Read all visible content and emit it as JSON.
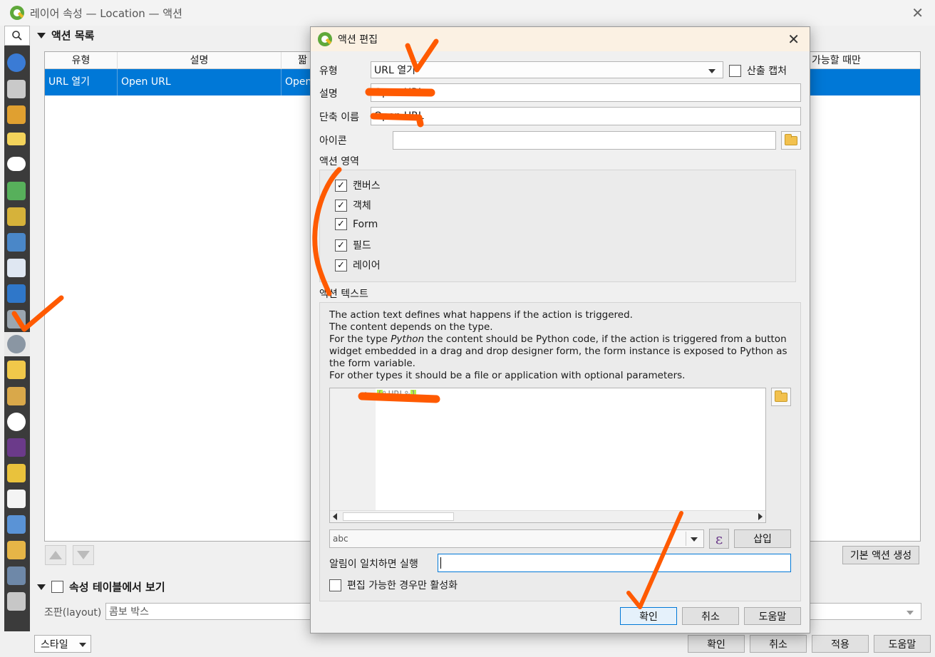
{
  "window": {
    "title": "레이어 속성 — Location — 액션",
    "close": "✕"
  },
  "sections": {
    "action_list": "액션 목록",
    "show_in_table": "속성 테이블에서 보기"
  },
  "table": {
    "headers": [
      "유형",
      "설명",
      "짧",
      "가능할 때만"
    ],
    "row": [
      "URL 열기",
      "Open URL",
      "Open"
    ]
  },
  "main": {
    "create_default": "기본 액션 생성",
    "layout_label": "조판(layout)",
    "layout_value": "콤보 박스",
    "style_button": "스타일",
    "ok": "확인",
    "cancel": "취소",
    "apply": "적용",
    "help": "도움말"
  },
  "dialog": {
    "title": "액션 편집",
    "close": "✕",
    "type_label": "유형",
    "type_value": "URL 열기",
    "capture_label": "산출 캡처",
    "desc_label": "설명",
    "desc_value": "Open URL",
    "short_label": "단축 이름",
    "short_value": "Open URL",
    "icon_label": "아이콘",
    "icon_value": "",
    "scope_label": "액션 영역",
    "scopes": [
      "캔버스",
      "객체",
      "Form",
      "필드",
      "레이어"
    ],
    "text_label": "액션 텍스트",
    "help_lines": [
      "The action text defines what happens if the action is triggered.",
      "The content depends on the type.",
      "For the type ",
      "Python",
      " the content should be Python code, if the action is triggered from a button widget embedded in a drag and drop designer form, the form instance is exposed to Python as the form variable.",
      "For other types it should be a file or application with optional parameters."
    ],
    "line_number": "1",
    "code_open": "[",
    "code_mid": "%URL%",
    "code_close": "]",
    "expr_value": "abc",
    "insert_button": "삽입",
    "notify_label": "알림이 일치하면 실행",
    "notify_value": "",
    "editable_label": "편집 가능한 경우만 활성화",
    "ok": "확인",
    "cancel": "취소",
    "help": "도움말"
  },
  "colors": {
    "selection": "#0078d7",
    "sidebar": "#3b3b3b",
    "annotation": "#ff5a00"
  }
}
